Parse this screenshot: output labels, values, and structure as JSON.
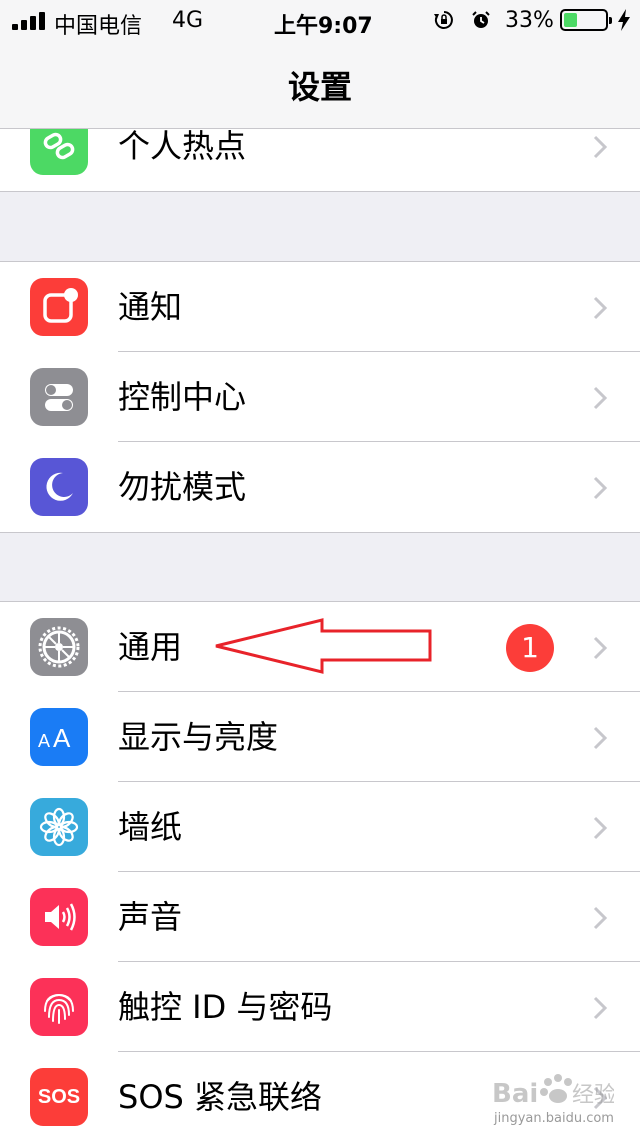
{
  "status_bar": {
    "carrier": "中国电信",
    "network": "4G",
    "time": "上午9:07",
    "battery_percent": "33%",
    "battery_level": 0.33,
    "icons": [
      "signal-icon",
      "rotation-lock-icon",
      "alarm-icon",
      "battery-icon",
      "charging-bolt-icon"
    ]
  },
  "nav": {
    "title": "设置"
  },
  "groups": [
    {
      "rows": [
        {
          "label": "个人热点",
          "icon": "personal-hotspot-icon",
          "color": "#4cd964"
        }
      ]
    },
    {
      "rows": [
        {
          "label": "通知",
          "icon": "notifications-icon",
          "color": "#fc3d39"
        },
        {
          "label": "控制中心",
          "icon": "control-center-icon",
          "color": "#8e8e93"
        },
        {
          "label": "勿扰模式",
          "icon": "do-not-disturb-icon",
          "color": "#5856d6"
        }
      ]
    },
    {
      "rows": [
        {
          "label": "通用",
          "icon": "gear-icon",
          "color": "#8e8e93",
          "badge": "1"
        },
        {
          "label": "显示与亮度",
          "icon": "display-brightness-icon",
          "color": "#1a7cf5"
        },
        {
          "label": "墙纸",
          "icon": "wallpaper-flower-icon",
          "color": "#37aadc"
        },
        {
          "label": "声音",
          "icon": "speaker-icon",
          "color": "#fc3158"
        },
        {
          "label": "触控 ID 与密码",
          "icon": "fingerprint-icon",
          "color": "#fc3158"
        },
        {
          "label": "SOS 紧急联络",
          "icon": "sos-icon",
          "color": "#fc3d39",
          "icon_text": "SOS"
        }
      ]
    }
  ],
  "watermark": {
    "text": "jingyan.baidu.com"
  }
}
